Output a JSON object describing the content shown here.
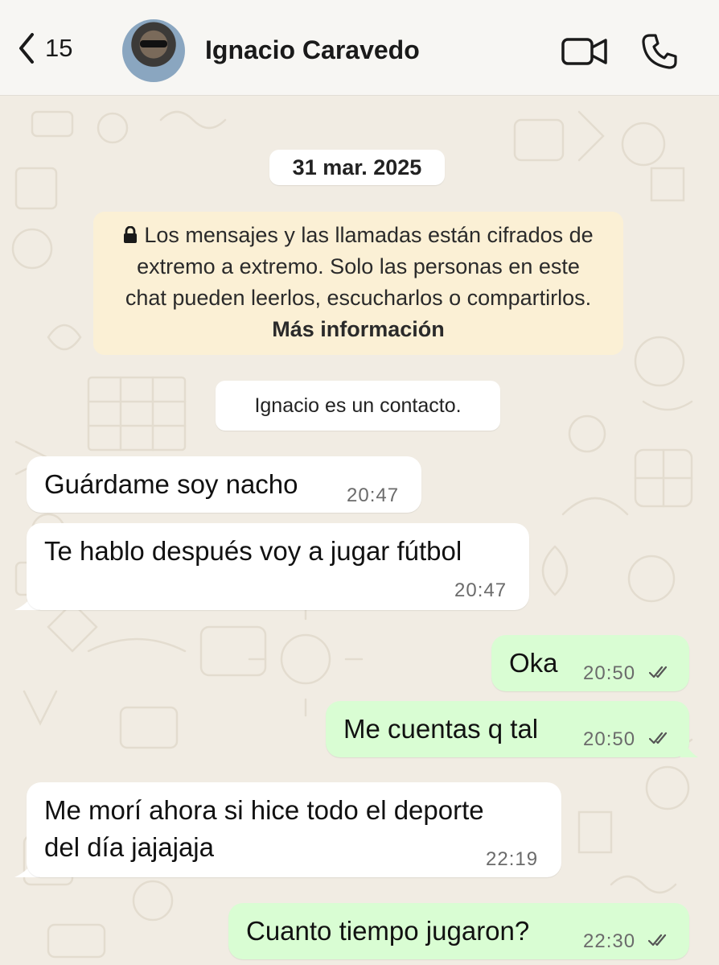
{
  "header": {
    "back_count": "15",
    "contact_name": "Ignacio Caravedo"
  },
  "chat": {
    "date_chip": "31 mar. 2025",
    "encryption_text": "Los mensajes y las llamadas están cifrados de extremo a extremo. Solo las personas en este chat pueden leerlos, escucharlos o compartirlos.",
    "encryption_link": "Más información",
    "contact_notice": "Ignacio es un contacto.",
    "messages": [
      {
        "direction": "incoming",
        "text": "Guárdame soy nacho",
        "time": "20:47"
      },
      {
        "direction": "incoming",
        "text": "Te hablo después voy a jugar fútbol",
        "time": "20:47"
      },
      {
        "direction": "outgoing",
        "text": "Oka",
        "time": "20:50",
        "status": "read"
      },
      {
        "direction": "outgoing",
        "text": "Me cuentas q tal",
        "time": "20:50",
        "status": "read"
      },
      {
        "direction": "incoming",
        "text_line1": "Me morí ahora si hice todo el deporte",
        "text_line2": "del día jajajaja",
        "time": "22:19"
      },
      {
        "direction": "outgoing",
        "text": "Cuanto tiempo jugaron?",
        "time": "22:30",
        "status": "read"
      }
    ]
  },
  "colors": {
    "header_bg": "#f7f6f3",
    "wallpaper_bg": "#f1ece3",
    "incoming_bubble": "#ffffff",
    "outgoing_bubble": "#d9fdd3",
    "encryption_bg": "#fbf0d5"
  },
  "icons": [
    "back-chevron-icon",
    "video-call-icon",
    "phone-icon",
    "lock-icon",
    "double-check-icon"
  ]
}
